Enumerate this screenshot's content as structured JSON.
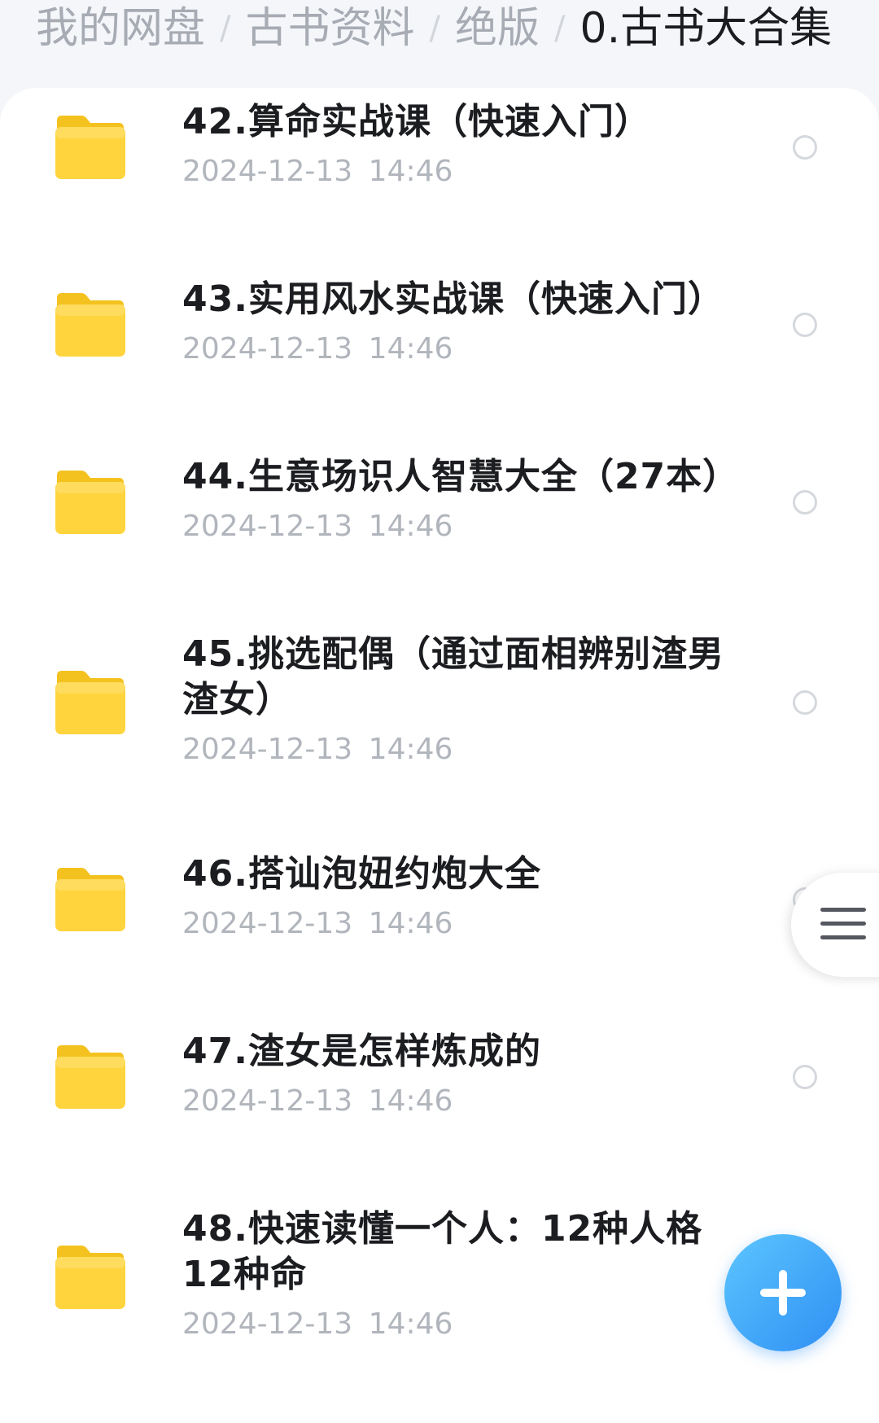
{
  "breadcrumb": {
    "items": [
      {
        "label": "我的网盘"
      },
      {
        "label": "古书资料"
      },
      {
        "label": "绝版"
      },
      {
        "label": "0.古书大合集"
      }
    ],
    "separator": "/"
  },
  "files": [
    {
      "name": "42.算命实战课（快速入门）",
      "date": "2024-12-13 14:46",
      "icon": "folder-icon"
    },
    {
      "name": "43.实用风水实战课（快速入门）",
      "date": "2024-12-13 14:46",
      "icon": "folder-icon"
    },
    {
      "name": "44.生意场识人智慧大全（27本）",
      "date": "2024-12-13 14:46",
      "icon": "folder-icon"
    },
    {
      "name": "45.挑选配偶（通过面相辨别渣男渣女）",
      "date": "2024-12-13 14:46",
      "icon": "folder-icon"
    },
    {
      "name": "46.搭讪泡妞约炮大全",
      "date": "2024-12-13 14:46",
      "icon": "folder-icon"
    },
    {
      "name": "47.渣女是怎样炼成的",
      "date": "2024-12-13 14:46",
      "icon": "folder-icon"
    },
    {
      "name": "48.快速读懂一个人：12种人格12种命",
      "date": "2024-12-13 14:46",
      "icon": "folder-icon"
    }
  ],
  "colors": {
    "folder": "#ffd43d",
    "accent": "#2f8ff3"
  }
}
